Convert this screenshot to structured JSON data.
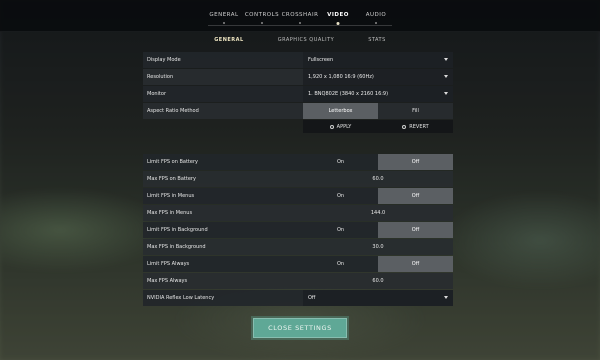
{
  "top_tabs": [
    "GENERAL",
    "CONTROLS",
    "CROSSHAIR",
    "VIDEO",
    "AUDIO"
  ],
  "sub_tabs": [
    "GENERAL",
    "GRAPHICS QUALITY",
    "STATS"
  ],
  "settings": {
    "display_mode": {
      "label": "Display Mode",
      "value": "Fullscreen"
    },
    "resolution": {
      "label": "Resolution",
      "value": "1,920 x 1,080 16:9 (60Hz)"
    },
    "monitor": {
      "label": "Monitor",
      "value": "1. BNQ802E (3840 x 2160 16:9)"
    },
    "aspect_ratio": {
      "label": "Aspect Ratio Method",
      "opt_a": "Letterbox",
      "opt_b": "Fill"
    },
    "apply_label": "APPLY",
    "revert_label": "REVERT",
    "limit_fps_battery": {
      "label": "Limit FPS on Battery",
      "on": "On",
      "off": "Off"
    },
    "max_fps_battery": {
      "label": "Max FPS on Battery",
      "value": "60.0"
    },
    "limit_fps_menus": {
      "label": "Limit FPS in Menus",
      "on": "On",
      "off": "Off"
    },
    "max_fps_menus": {
      "label": "Max FPS in Menus",
      "value": "144.0"
    },
    "limit_fps_background": {
      "label": "Limit FPS in Background",
      "on": "On",
      "off": "Off"
    },
    "max_fps_background": {
      "label": "Max FPS in Background",
      "value": "30.0"
    },
    "limit_fps_always": {
      "label": "Limit FPS Always",
      "on": "On",
      "off": "Off"
    },
    "max_fps_always": {
      "label": "Max FPS Always",
      "value": "60.0"
    },
    "nvidia_reflex": {
      "label": "NVIDIA Reflex Low Latency",
      "value": "Off"
    }
  },
  "close_label": "CLOSE SETTINGS"
}
